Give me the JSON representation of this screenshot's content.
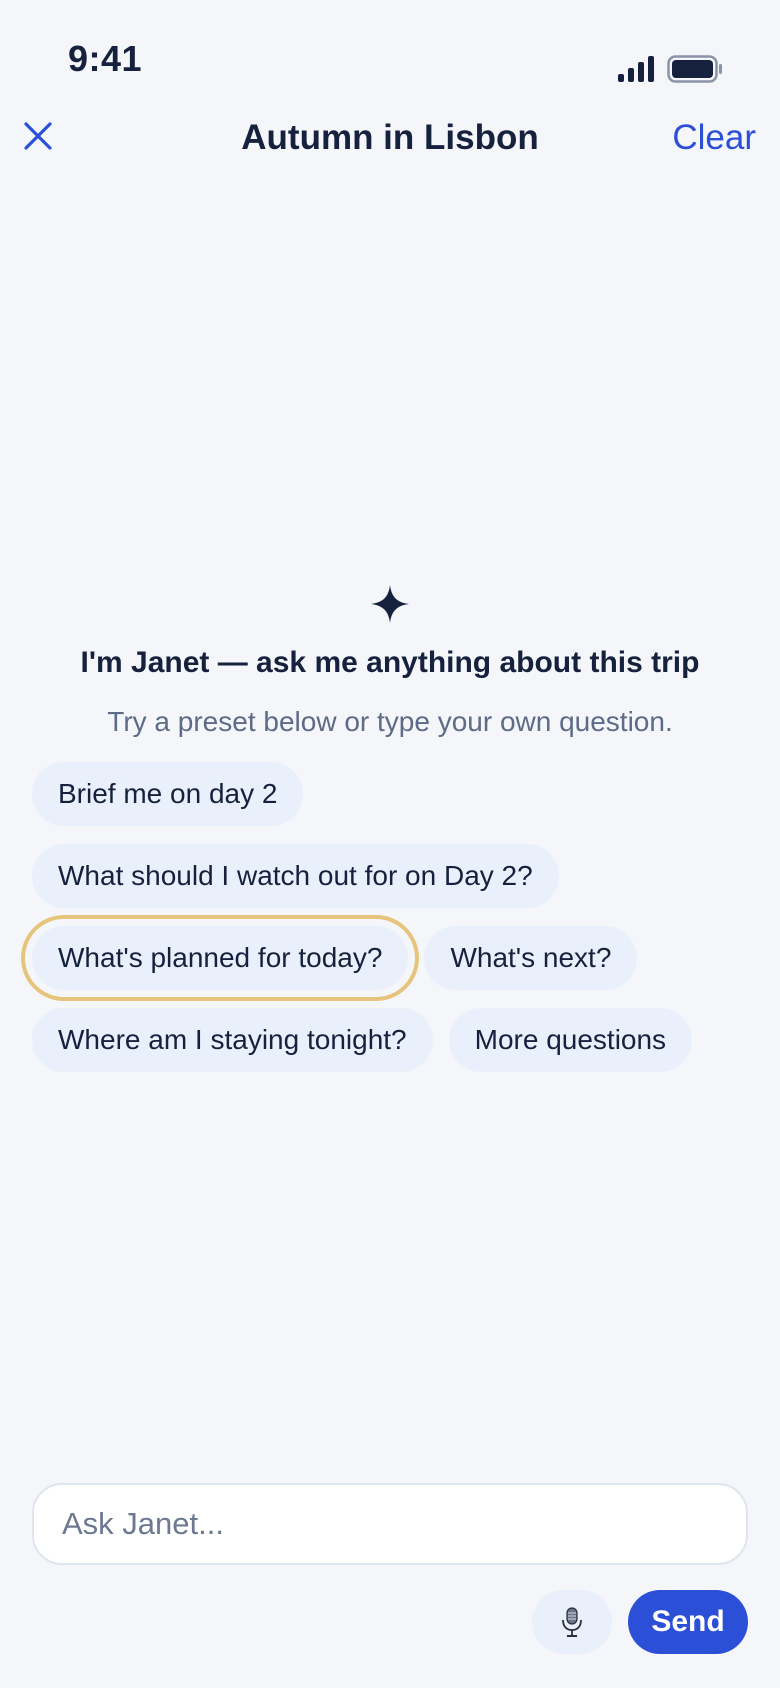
{
  "status_bar": {
    "time": "9:41",
    "icons": [
      "signal-icon",
      "battery-icon"
    ]
  },
  "nav": {
    "close_icon": "close-icon",
    "title": "Autumn in Lisbon",
    "clear_label": "Clear"
  },
  "intro": {
    "icon": "sparkle-icon",
    "title": "I'm Janet — ask me anything about this trip",
    "subtitle": "Try a preset below or type your own question."
  },
  "presets": [
    {
      "label": "Brief me on day 2"
    },
    {
      "label": "What should I watch out for on Day 2?"
    },
    {
      "label": "What's planned for today?",
      "focused": true
    },
    {
      "label": "What's next?"
    },
    {
      "label": "Where am I staying tonight?"
    },
    {
      "label": "More questions"
    }
  ],
  "composer": {
    "placeholder": "Ask Janet...",
    "value": "",
    "mic_icon": "microphone-icon",
    "send_label": "Send"
  },
  "colors": {
    "accent": "#2c4fd8",
    "text": "#16213e",
    "muted": "#5d6b86",
    "chip_bg": "#eaf0fb",
    "focus_ring": "#e7c47c",
    "background": "#f4f6fa"
  }
}
